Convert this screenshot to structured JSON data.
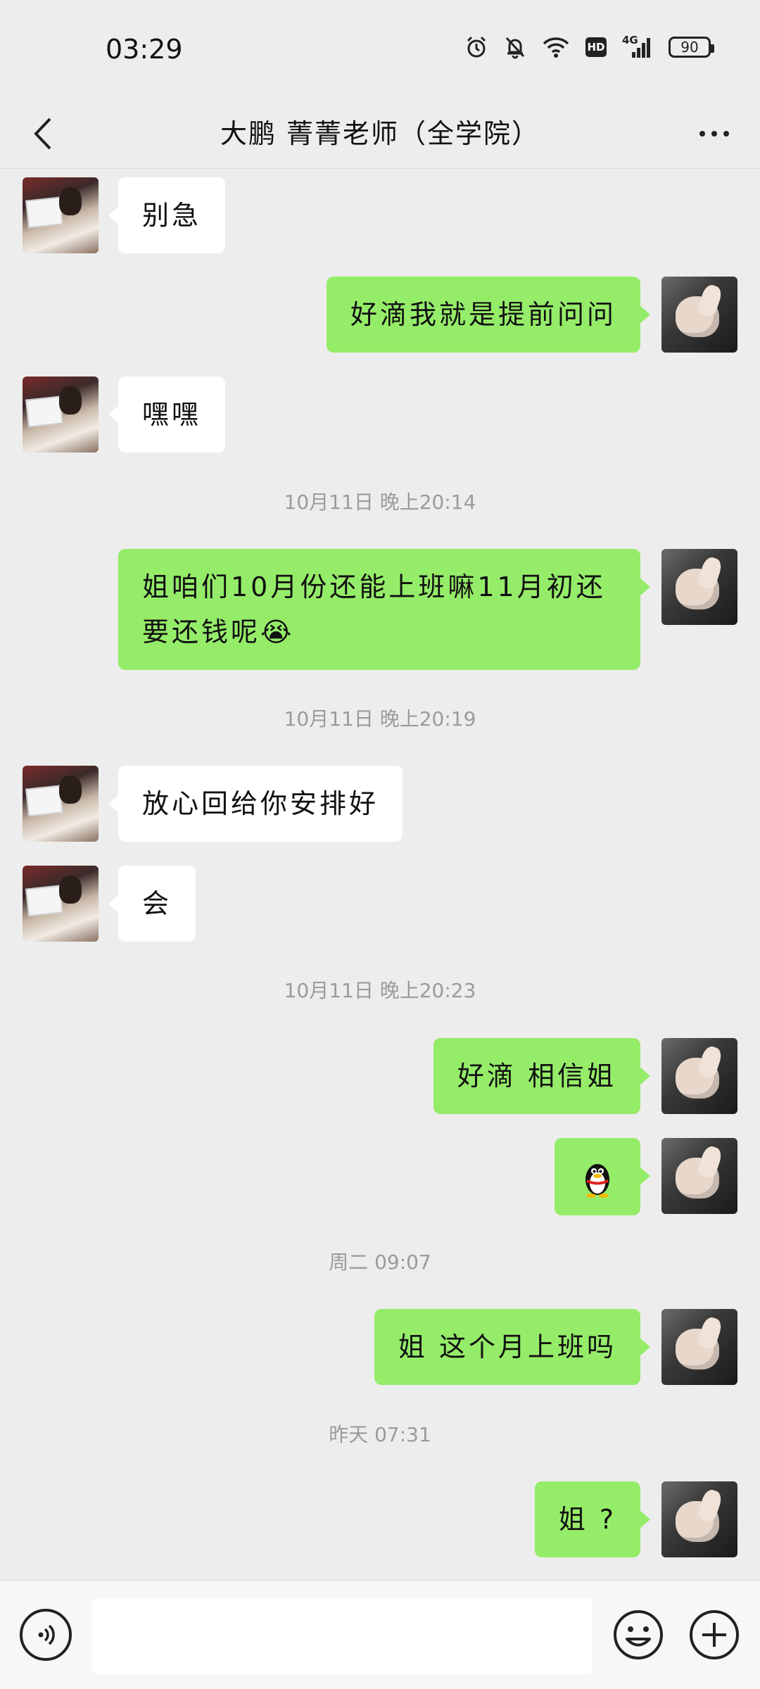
{
  "status_bar": {
    "time": "03:29",
    "network": "4G",
    "hd": "HD",
    "battery": "90"
  },
  "header": {
    "title": "大鹏 菁菁老师（全学院）"
  },
  "messages": [
    {
      "side": "left",
      "text": "别急"
    },
    {
      "side": "right",
      "text": "好滴我就是提前问问"
    },
    {
      "side": "left",
      "text": "嘿嘿"
    },
    {
      "type": "time",
      "text": "10月11日 晚上20:14"
    },
    {
      "side": "right",
      "text": "姐咱们10月份还能上班嘛11月初还要还钱呢😭"
    },
    {
      "type": "time",
      "text": "10月11日 晚上20:19"
    },
    {
      "side": "left",
      "text": "放心回给你安排好"
    },
    {
      "side": "left",
      "text": "会"
    },
    {
      "type": "time",
      "text": "10月11日 晚上20:23"
    },
    {
      "side": "right",
      "text": "好滴 相信姐"
    },
    {
      "side": "right",
      "sticker": "qq-penguin-icon"
    },
    {
      "type": "time",
      "text": "周二 09:07"
    },
    {
      "side": "right",
      "text": "姐 这个月上班吗"
    },
    {
      "type": "time",
      "text": "昨天 07:31"
    },
    {
      "side": "right",
      "text": "姐 ?"
    }
  ],
  "input_bar": {
    "placeholder": "",
    "voice_icon": "voice-icon",
    "emoji_icon": "emoji-icon",
    "plus_icon": "plus-icon"
  },
  "colors": {
    "background": "#ededed",
    "self_bubble": "#95ec69",
    "other_bubble": "#ffffff",
    "timestamp": "#9b9b9b"
  }
}
